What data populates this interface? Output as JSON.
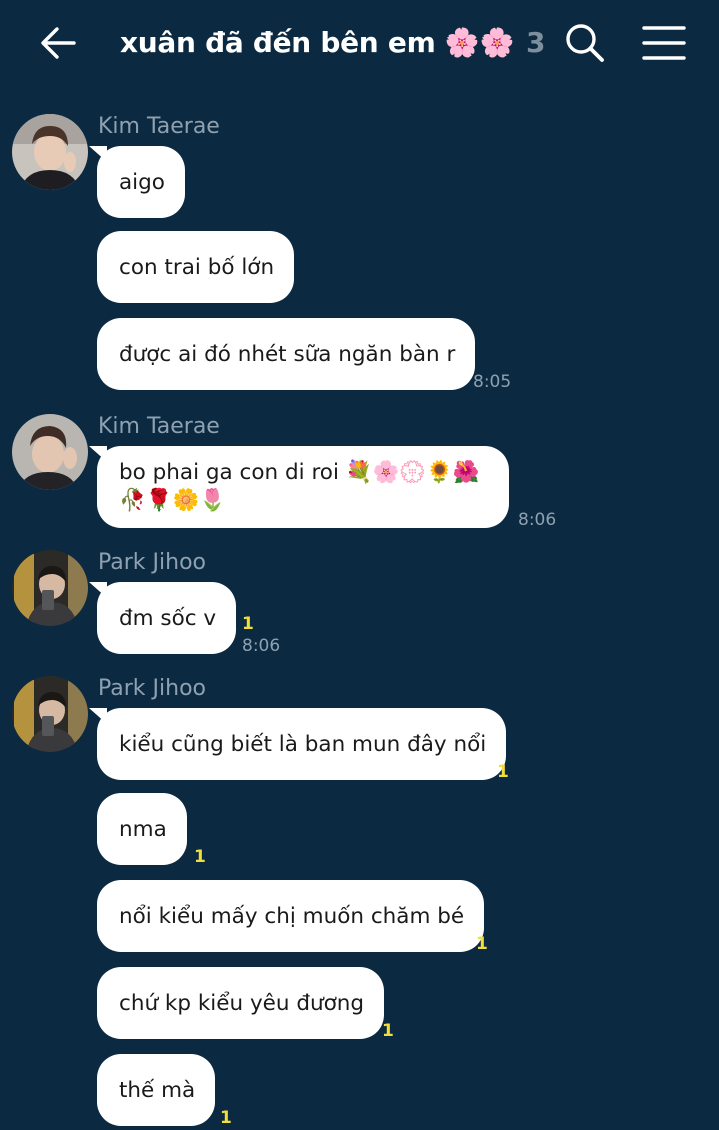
{
  "header": {
    "back_icon": "arrow-left-icon",
    "title": "xuân đã đến bên em 🌸🌸",
    "member_count": "3",
    "search_icon": "search-icon",
    "menu_icon": "hamburger-menu-icon"
  },
  "messages": [
    {
      "sender": "Kim Taerae",
      "text": "aigo"
    },
    {
      "text": "con trai bố lớn"
    },
    {
      "text": "được ai đó nhét sữa ngăn bàn r",
      "time": "8:05"
    },
    {
      "sender": "Kim Taerae",
      "text": "bo phai ga con di roi 💐🌸💮🌻🌺",
      "text_line2": "🥀🌹🌼🌷",
      "time": "8:06"
    },
    {
      "sender": "Park Jihoo",
      "text": "đm sốc v",
      "unread": "1",
      "time": "8:06"
    },
    {
      "sender": "Park Jihoo",
      "text": "kiểu cũng biết là ban mun đây nổi",
      "unread": "1"
    },
    {
      "text": "nma",
      "unread": "1"
    },
    {
      "text": "nổi kiểu mấy chị muốn chăm bé",
      "unread": "1"
    },
    {
      "text": "chứ kp kiểu yêu đương",
      "unread": "1"
    },
    {
      "text": "thế mà",
      "unread": "1"
    }
  ],
  "colors": {
    "background": "#0b2940",
    "bubble": "#ffffff",
    "sender_name": "#8fa1b1",
    "unread_count": "#f1de3a"
  }
}
